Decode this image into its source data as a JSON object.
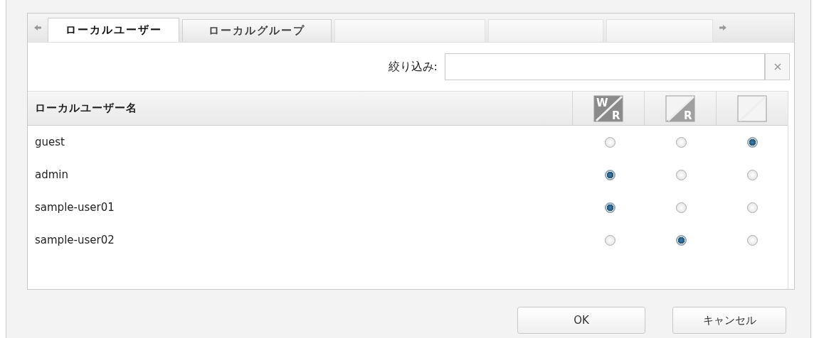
{
  "tabs": [
    {
      "label": "ローカルユーザー",
      "selected": true,
      "disabled": false
    },
    {
      "label": "ローカルグループ",
      "selected": false,
      "disabled": false
    },
    {
      "selected": false,
      "disabled": true
    },
    {
      "selected": false,
      "disabled": true
    },
    {
      "selected": false,
      "disabled": true
    }
  ],
  "filter": {
    "label": "絞り込み:"
  },
  "table": {
    "name_column": "ローカルユーザー名",
    "access_columns": [
      {
        "kind": "read_write",
        "top": "W",
        "bottom": "R"
      },
      {
        "kind": "read_only",
        "bottom": "R"
      },
      {
        "kind": "none"
      }
    ],
    "rows": [
      {
        "name": "guest",
        "access": [
          {
            "selected": false
          },
          {
            "selected": false
          },
          {
            "selected": true
          }
        ]
      },
      {
        "name": "admin",
        "access": [
          {
            "selected": true
          },
          {
            "selected": false
          },
          {
            "selected": false
          }
        ]
      },
      {
        "name": "sample-user01",
        "access": [
          {
            "selected": true
          },
          {
            "selected": false
          },
          {
            "selected": false
          }
        ]
      },
      {
        "name": "sample-user02",
        "access": [
          {
            "selected": false
          },
          {
            "selected": true
          },
          {
            "selected": false
          }
        ]
      }
    ]
  },
  "buttons": [
    "OK",
    "キャンセル"
  ]
}
